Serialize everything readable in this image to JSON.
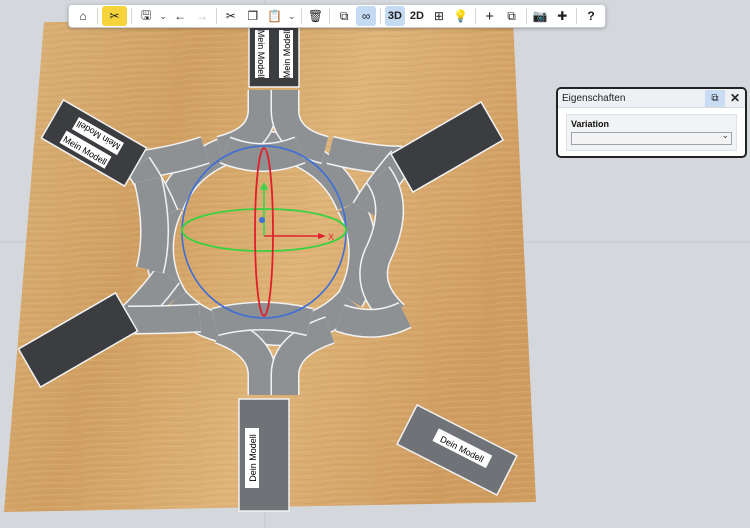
{
  "toolbar": {
    "buttons": [
      {
        "name": "home-icon",
        "glyph": "⌂"
      },
      {
        "name": "tools-icon",
        "glyph": "✂"
      },
      {
        "name": "save-icon",
        "glyph": "🖫"
      },
      {
        "name": "undo-icon",
        "glyph": "←"
      },
      {
        "name": "redo-icon",
        "glyph": "→"
      },
      {
        "name": "cut-icon",
        "glyph": "✂"
      },
      {
        "name": "copy-icon",
        "glyph": "❐"
      },
      {
        "name": "paste-icon",
        "glyph": "📋"
      },
      {
        "name": "delete-icon",
        "glyph": "🗑"
      },
      {
        "name": "duplicate-icon",
        "glyph": "⧉"
      },
      {
        "name": "link-icon",
        "glyph": "∞"
      },
      {
        "name": "grid-icon",
        "glyph": "⊞"
      },
      {
        "name": "bulb-icon",
        "glyph": "💡"
      },
      {
        "name": "add-icon",
        "glyph": "+"
      },
      {
        "name": "clone-icon",
        "glyph": "⧉"
      },
      {
        "name": "camera-icon",
        "glyph": "📷"
      },
      {
        "name": "puzzle-icon",
        "glyph": "✚"
      },
      {
        "name": "help-icon",
        "glyph": "?"
      }
    ],
    "view_3d_label": "3D",
    "view_2d_label": "2D"
  },
  "properties_panel": {
    "title": "Eigenschaften",
    "close_glyph": "✕",
    "popout_glyph": "⧉",
    "variation_label": "Variation",
    "variation_value": ""
  },
  "scene": {
    "labels": {
      "top_arm": "Mein Modell",
      "top_left_arm_a": "Mein Modell",
      "top_left_arm_b": "Mein Modell",
      "bottom_arm": "Dein Modell",
      "separate_block": "Dein Modell"
    },
    "axis_x_label": "X",
    "colors": {
      "wood": "#d8ad71",
      "track": "#8e9194",
      "track_edge": "#f2f2f2",
      "dark_block": "#3b3d40",
      "axis_x": "#e0212b",
      "axis_y": "#3fd34a",
      "ring_red": "#e01f2a",
      "ring_green": "#39d23f",
      "ring_blue": "#3d6fd8"
    }
  }
}
